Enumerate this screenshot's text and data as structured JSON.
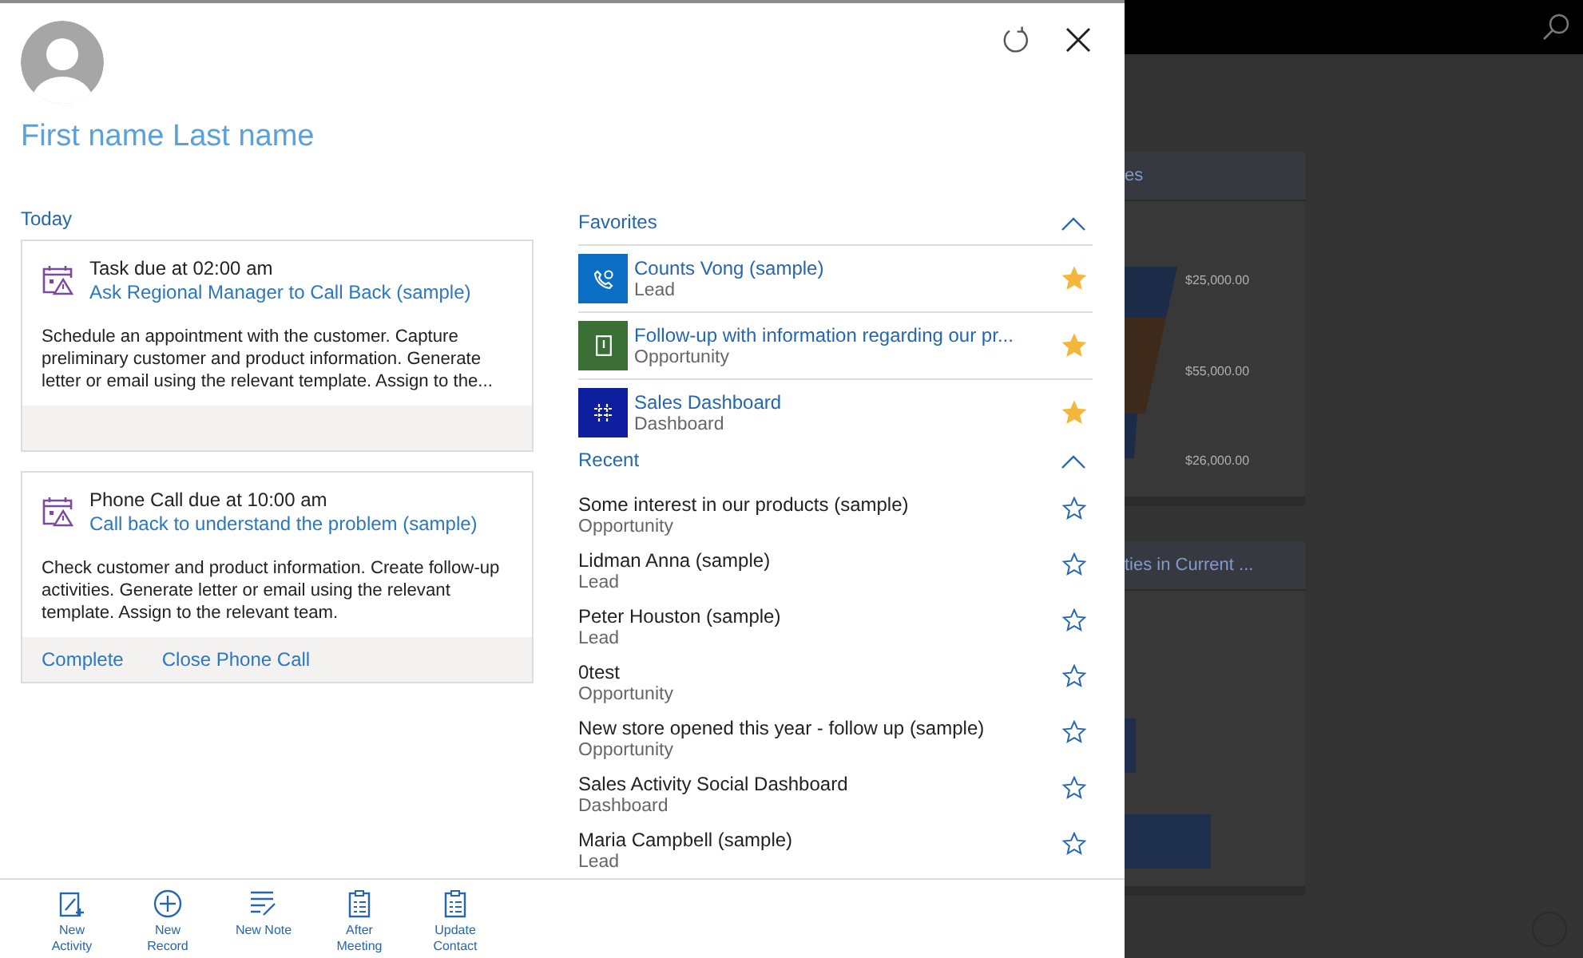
{
  "profile": {
    "name": "First name Last name"
  },
  "today": {
    "title": "Today",
    "activities": [
      {
        "due": "Task due at 02:00 am",
        "subject": "Ask Regional Manager to Call Back (sample)",
        "description": "Schedule an appointment with the customer. Capture preliminary customer and product information. Generate letter or email using the relevant template. Assign to the..."
      },
      {
        "due": "Phone Call due at 10:00 am",
        "subject": "Call back to understand the problem (sample)",
        "description": "Check customer and product information. Create follow-up activities. Generate letter or email using the relevant template. Assign to the relevant team.",
        "actions": [
          "Complete",
          "Close Phone Call"
        ]
      }
    ]
  },
  "favorites": {
    "title": "Favorites",
    "expanded": true,
    "items": [
      {
        "kind": "lead",
        "color": "#0a6ec4",
        "name": "Counts Vong (sample)",
        "type": "Lead",
        "starred": true
      },
      {
        "kind": "opportunity",
        "color": "#3b6e35",
        "name": "Follow-up with information regarding our pr...",
        "type": "Opportunity",
        "starred": true
      },
      {
        "kind": "dashboard",
        "color": "#0d1e9e",
        "name": "Sales Dashboard",
        "type": "Dashboard",
        "starred": true
      }
    ]
  },
  "recent": {
    "title": "Recent",
    "expanded": true,
    "items": [
      {
        "name": "Some interest in our products (sample)",
        "type": "Opportunity",
        "starred": false
      },
      {
        "name": "Lidman Anna (sample)",
        "type": "Lead",
        "starred": false
      },
      {
        "name": "Peter Houston (sample)",
        "type": "Lead",
        "starred": false
      },
      {
        "name": "0test",
        "type": "Opportunity",
        "starred": false
      },
      {
        "name": "New store opened this year - follow up (sample)",
        "type": "Opportunity",
        "starred": false
      },
      {
        "name": "Sales Activity Social Dashboard",
        "type": "Dashboard",
        "starred": false
      },
      {
        "name": "Maria Campbell (sample)",
        "type": "Lead",
        "starred": false
      }
    ]
  },
  "toolbar": [
    {
      "kind": "activity",
      "label": "New Activity"
    },
    {
      "kind": "record",
      "label": "New Record"
    },
    {
      "kind": "note",
      "label": "New Note"
    },
    {
      "kind": "meeting",
      "label": "After Meeting"
    },
    {
      "kind": "contact",
      "label": "Update Contact"
    }
  ],
  "background": {
    "cards": [
      {
        "kind": "funnel",
        "title": "es",
        "labels": [
          "$25,000.00",
          "$55,000.00",
          "$26,000.00"
        ]
      },
      {
        "kind": "bars",
        "title": "ties in Current ..."
      }
    ]
  }
}
